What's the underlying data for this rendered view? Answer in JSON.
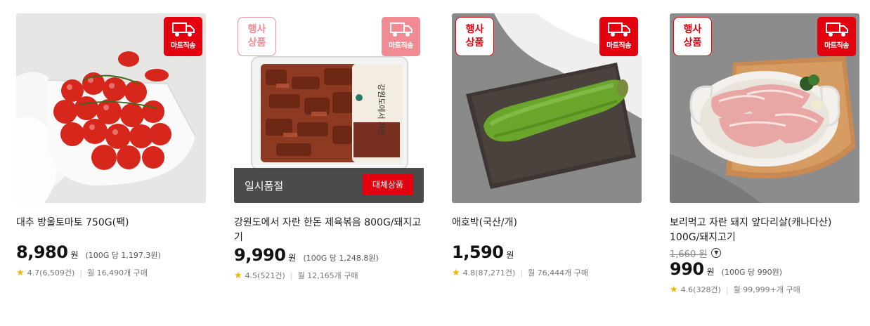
{
  "products": [
    {
      "shipping_badge": "마트직송",
      "name": "대추 방울토마토 750G(팩)",
      "price": "8,980",
      "currency": "원",
      "unit_price": "(100G 당 1,197.3원)",
      "rating": "4.7(6,509건)",
      "sales": "월 16,490개 구매"
    },
    {
      "shipping_badge": "마트직송",
      "event_badge": "행사\n상품",
      "soldout_text": "일시품절",
      "alt_button": "대체상품",
      "name": "강원도에서 자란 한돈 제육볶음 800G/돼지고기",
      "price": "9,990",
      "currency": "원",
      "unit_price": "(100G 당 1,248.8원)",
      "rating": "4.5(521건)",
      "sales": "월 12,165개 구매"
    },
    {
      "shipping_badge": "마트직송",
      "event_badge": "행사\n상품",
      "name": "애호박(국산/개)",
      "price": "1,590",
      "currency": "원",
      "unit_price": "",
      "rating": "4.8(87,271건)",
      "sales": "월 76,444개 구매"
    },
    {
      "shipping_badge": "마트직송",
      "event_badge": "행사\n상품",
      "name": "보리먹고 자란 돼지 앞다리살(캐나다산) 100G/돼지고기",
      "original_price": "1,660",
      "original_currency": "원",
      "price": "990",
      "currency": "원",
      "unit_price": "(100G 당 990원)",
      "rating": "4.6(328건)",
      "sales": "월 99,999+개 구매"
    }
  ],
  "colors": {
    "accent": "#e3000f",
    "star": "#f4b400"
  },
  "icons": {
    "shipping": "delivery-truck-icon",
    "rating": "star-icon",
    "expand": "chevron-down-icon"
  }
}
